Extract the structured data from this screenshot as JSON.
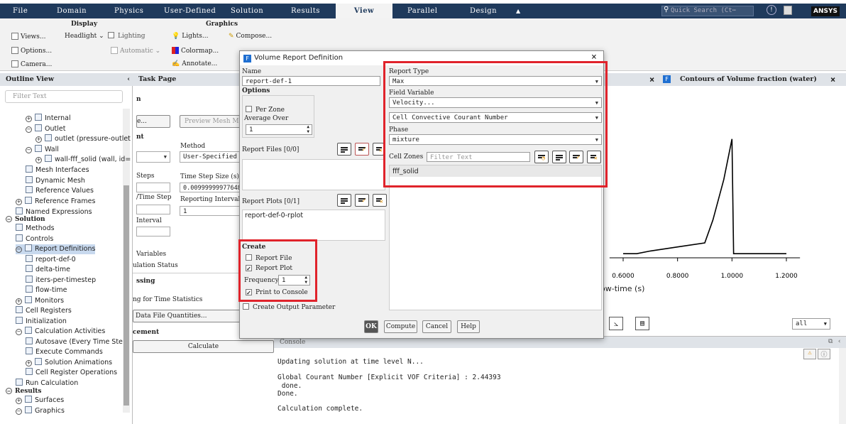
{
  "menu": {
    "items": [
      "File",
      "Domain",
      "Physics",
      "User-Defined",
      "Solution",
      "Results",
      "View",
      "Parallel",
      "Design"
    ],
    "active": "View",
    "collapse_glyph": "▲",
    "search_placeholder": "Quick Search (Ct⋯",
    "brand": "ANSYS"
  },
  "ribbon": {
    "display_header": "Display",
    "graphics_header": "Graphics",
    "views": "Views...",
    "headlight": "Headlight",
    "lighting": "Lighting",
    "options": "Options...",
    "automatic": "Automatic",
    "camera": "Camera...",
    "lights": "Lights...",
    "compose": "Compose...",
    "colormap": "Colormap...",
    "annotate": "Annotate..."
  },
  "outline": {
    "title": "Outline View",
    "filter_placeholder": "Filter Text",
    "items": [
      {
        "label": "Internal",
        "toggle": "+"
      },
      {
        "label": "Outlet",
        "toggle": "−"
      },
      {
        "label": "outlet (pressure-outlet",
        "toggle": "+"
      },
      {
        "label": "Wall",
        "toggle": "−"
      },
      {
        "label": "wall-fff_solid (wall, id=",
        "toggle": "+"
      },
      {
        "label": "Mesh Interfaces"
      },
      {
        "label": "Dynamic Mesh"
      },
      {
        "label": "Reference Values"
      },
      {
        "label": "Reference Frames",
        "toggle": "+"
      },
      {
        "label": "Named Expressions"
      },
      {
        "label": "Solution",
        "toggle": "−"
      },
      {
        "label": "Methods"
      },
      {
        "label": "Controls"
      },
      {
        "label": "Report Definitions",
        "toggle": "−"
      },
      {
        "label": "report-def-0"
      },
      {
        "label": "delta-time"
      },
      {
        "label": "iters-per-timestep"
      },
      {
        "label": "flow-time"
      },
      {
        "label": "Monitors",
        "toggle": "+"
      },
      {
        "label": "Cell Registers"
      },
      {
        "label": "Initialization"
      },
      {
        "label": "Calculation Activities",
        "toggle": "−"
      },
      {
        "label": "Autosave (Every Time Ste"
      },
      {
        "label": "Execute Commands"
      },
      {
        "label": "Solution Animations",
        "toggle": "+"
      },
      {
        "label": "Cell Register Operations"
      },
      {
        "label": "Run Calculation"
      },
      {
        "label": "Results",
        "toggle": "−"
      },
      {
        "label": "Surfaces",
        "toggle": "+"
      },
      {
        "label": "Graphics",
        "toggle": "−"
      }
    ]
  },
  "task": {
    "title": "Task Page",
    "n_label": "n",
    "e_btn": "e...",
    "preview_mesh": "Preview Mesh Mot",
    "nt_label": "nt",
    "method_label": "Method",
    "method_value": "User-Specified",
    "steps_label": "Steps",
    "time_step_label": "Time Step Size (s)",
    "time_step_value": "0.009999999776483",
    "time_step_short": "/Time Step",
    "reporting_label": "Reporting Interval",
    "reporting_value": "1",
    "interval_label": "Interval",
    "variables": "Variables",
    "ulation_status": "ulation Status",
    "ssing": "ssing",
    "time_stats": "ng for Time Statistics",
    "data_file": "Data File Quantities...",
    "cement": "cement",
    "calculate": "Calculate"
  },
  "graphics": {
    "title": "Contours of Volume fraction (water)",
    "x_label": "ow-time (s)",
    "zoom_value": "all"
  },
  "chart_data": {
    "type": "line",
    "x_ticks": [
      "0.6000",
      "0.8000",
      "1.0000",
      "1.2000"
    ],
    "xlabel": "ow-time (s)",
    "x": [
      0.6,
      0.65,
      0.7,
      0.8,
      0.9,
      0.93,
      0.97,
      1.0,
      1.006,
      1.012,
      1.2
    ],
    "y": [
      0.02,
      0.02,
      0.04,
      0.07,
      0.1,
      0.27,
      0.57,
      0.87,
      0.02,
      0.02,
      0.02
    ],
    "xlim": [
      0.55,
      1.25
    ],
    "ylim": [
      0,
      1
    ]
  },
  "console": {
    "title": "Console",
    "lines": [
      "Updating solution at time level N...",
      "",
      "Global Courant Number [Explicit VOF Criteria] : 2.44393",
      " done.",
      "Done.",
      "",
      "Calculation complete."
    ]
  },
  "dialog": {
    "title": "Volume Report Definition",
    "name_label": "Name",
    "name_value": "report-def-1",
    "options_label": "Options",
    "per_zone": "Per Zone",
    "average_over_label": "Average Over",
    "average_over_value": "1",
    "report_files_label": "Report Files [0/0]",
    "report_plots_label": "Report Plots [0/1]",
    "report_plot_item": "report-def-0-rplot",
    "create_label": "Create",
    "report_file": "Report File",
    "report_plot": "Report Plot",
    "frequency_label": "Frequency",
    "frequency_value": "1",
    "print_console": "Print to Console",
    "create_output": "Create Output Parameter",
    "report_type_label": "Report Type",
    "report_type_value": "Max",
    "field_variable_label": "Field Variable",
    "field_variable_value": "Velocity...",
    "field_sub_value": "Cell Convective Courant Number",
    "phase_label": "Phase",
    "phase_value": "mixture",
    "cell_zones_label": "Cell Zones",
    "cell_zones_placeholder": "Filter Text",
    "cell_zone_item": "fff_solid",
    "ok": "OK",
    "compute": "Compute",
    "cancel": "Cancel",
    "help": "Help",
    "close": "×"
  },
  "colors": {
    "menubar": "#1f3a5c",
    "highlight": "#e0232b",
    "selection": "#c8d9ee"
  }
}
